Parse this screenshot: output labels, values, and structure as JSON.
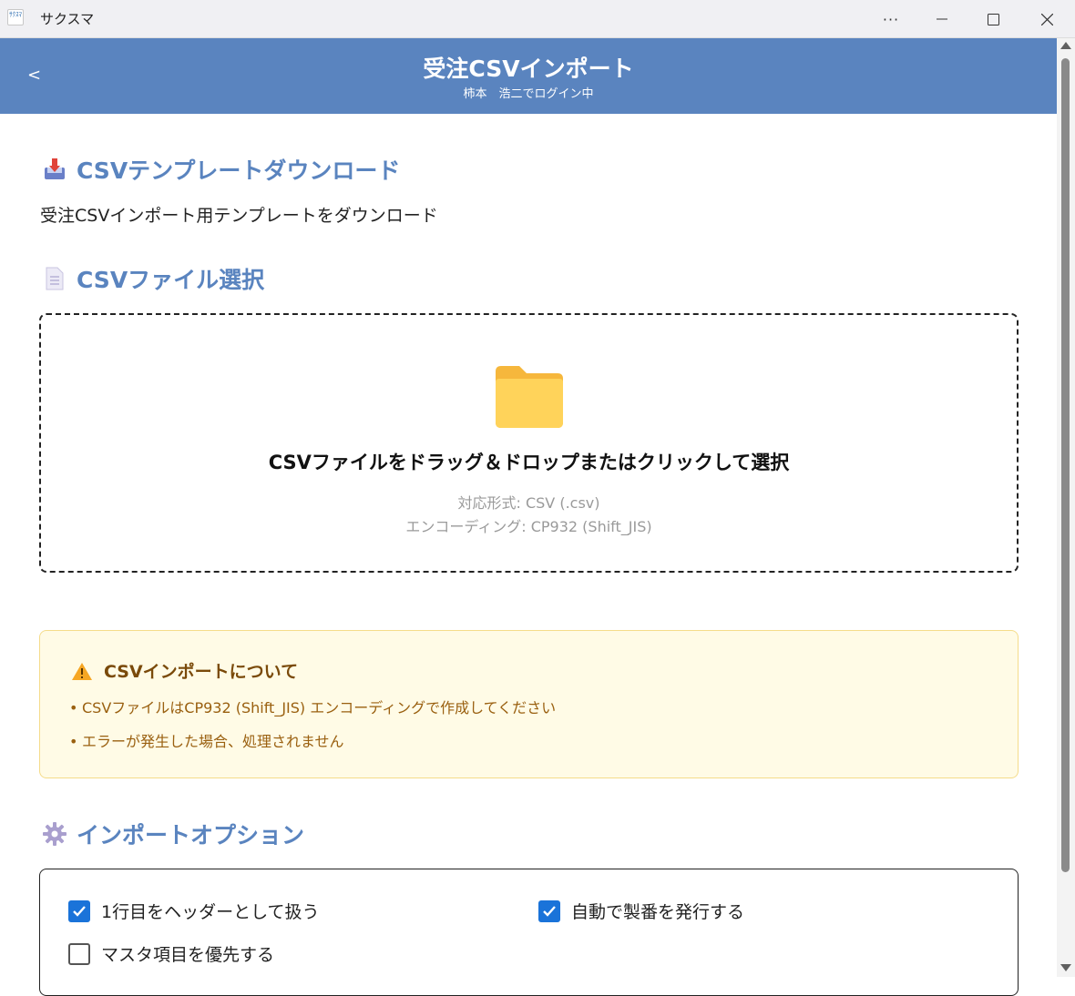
{
  "window": {
    "title": "サクスマ",
    "app_icon_text": "ｻｸｽﾏ",
    "more_glyph": "···"
  },
  "header": {
    "back_label": "<",
    "title": "受注CSVインポート",
    "subtitle": "柿本　浩二でログイン中"
  },
  "template_section": {
    "heading": "CSVテンプレートダウンロード",
    "icon": "inbox-download-icon",
    "description": "受注CSVインポート用テンプレートをダウンロード"
  },
  "file_section": {
    "heading": "CSVファイル選択",
    "icon": "document-icon",
    "dropzone": {
      "icon": "folder-icon",
      "main_text": "CSVファイルをドラッグ＆ドロップまたはクリックして選択",
      "format_text": "対応形式: CSV (.csv)",
      "encoding_text": "エンコーディング: CP932 (Shift_JIS)"
    }
  },
  "notice": {
    "icon": "warning-icon",
    "title": "CSVインポートについて",
    "bullet": "•",
    "items": [
      "CSVファイルはCP932 (Shift_JIS) エンコーディングで作成してください",
      "エラーが発生した場合、処理されません"
    ]
  },
  "options_section": {
    "heading": "インポートオプション",
    "icon": "gear-icon",
    "options": [
      {
        "label": "1行目をヘッダーとして扱う",
        "checked": true
      },
      {
        "label": "自動で製番を発行する",
        "checked": true
      },
      {
        "label": "マスタ項目を優先する",
        "checked": false
      }
    ]
  },
  "colors": {
    "header_bg": "#5a84bf",
    "accent": "#1a73d9",
    "notice_bg": "#fffbe6",
    "notice_text": "#9a6010"
  }
}
